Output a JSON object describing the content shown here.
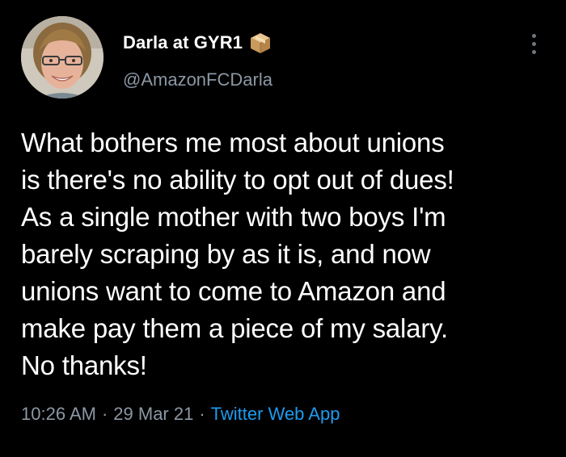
{
  "tweet": {
    "display_name": "Darla at GYR1",
    "name_badge_icon": "package-box-emoji",
    "handle": "@AmazonFCDarla",
    "text": "What bothers me most about unions\nis there's no ability to opt out of dues!\nAs a single mother with two boys I'm\nbarely scraping by as it is, and now\nunions want to come to Amazon and\nmake pay them a piece of my salary.\nNo thanks!",
    "time": "10:26 AM",
    "separator": "·",
    "date": "29 Mar 21",
    "source": "Twitter Web App"
  },
  "colors": {
    "background": "#000000",
    "primary_text": "#ffffff",
    "secondary_text": "#8b98a5",
    "link": "#1d9bf0"
  }
}
